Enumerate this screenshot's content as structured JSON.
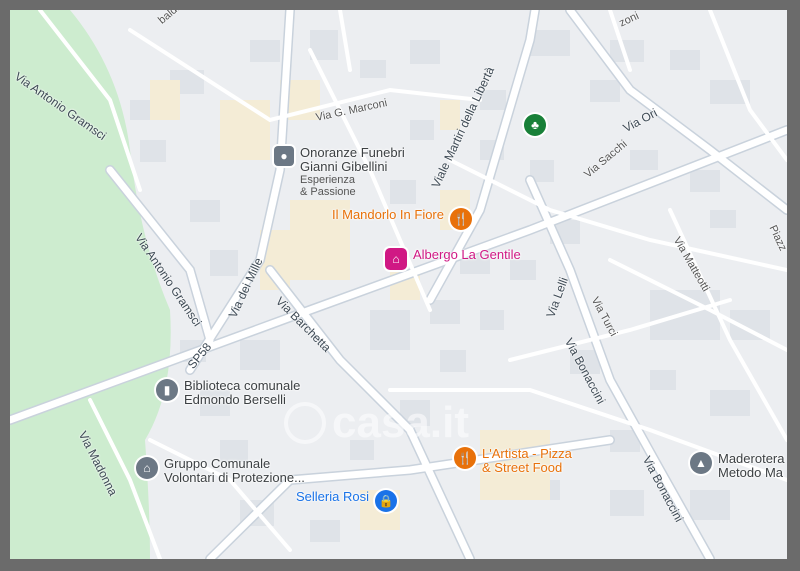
{
  "watermark": "casa.it",
  "pois": {
    "onoranze": {
      "name1": "Onoranze Funebri",
      "name2": "Gianni Gibellini",
      "sub1": "Esperienza",
      "sub2": "& Passione",
      "icon": "funeral-home-icon"
    },
    "mandorlo": {
      "name": "Il Mandorlo In Fiore",
      "icon": "restaurant-icon",
      "color": "#e8710a"
    },
    "albergo": {
      "name": "Albergo La Gentile",
      "icon": "hotel-icon",
      "color": "#d01884"
    },
    "biblioteca": {
      "name1": "Biblioteca comunale",
      "name2": "Edmondo Berselli",
      "icon": "library-icon"
    },
    "gruppo": {
      "name1": "Gruppo Comunale",
      "name2": "Volontari di Protezione...",
      "icon": "civic-building-icon"
    },
    "artista": {
      "name1": "L'Artista - Pizza",
      "name2": "& Street Food",
      "icon": "restaurant-icon",
      "color": "#e8710a"
    },
    "selleria": {
      "name": "Selleria Rosi",
      "icon": "shopping-bag-icon",
      "color": "#1a73e8"
    },
    "maderotera": {
      "name1": "Maderotera",
      "name2": "Metodo Ma",
      "icon": "school-icon"
    },
    "park": {
      "icon": "park-tree-icon"
    }
  },
  "streets": {
    "baldi": "baldi",
    "gramsci1": "Via Antonio Gramsci",
    "gramsci2": "Via Antonio Gramsci",
    "marconi": "Via G. Marconi",
    "martiri": "Viale Martiri della Libertà",
    "ori": "Via Ori",
    "sacchi": "Via Sacchi",
    "zoni": "zoni",
    "piazza": "Piazz",
    "mille": "Via dei Mille",
    "sp58": "SP58",
    "barchetta": "Via Barchetta",
    "madonna": "Via Madonna",
    "lelli": "Via Lelli",
    "turci": "Via Turci",
    "matteotti": "Via Matteotti",
    "bonaccini1": "Via Bonaccini",
    "bonaccini2": "Via Bonaccini"
  }
}
